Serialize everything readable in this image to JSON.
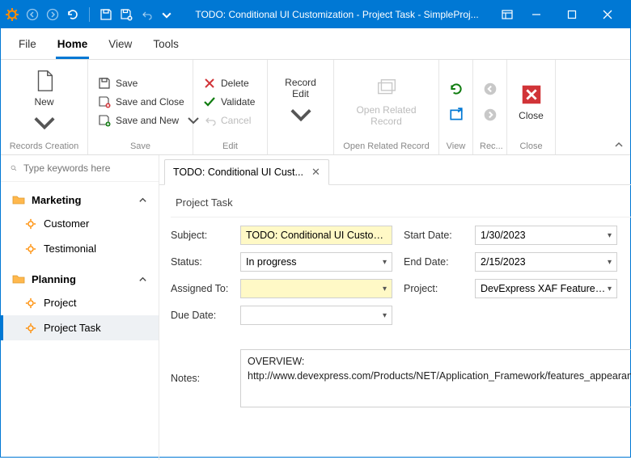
{
  "window": {
    "title": "TODO: Conditional UI Customization - Project Task - SimpleProj..."
  },
  "tabs": {
    "file": "File",
    "home": "Home",
    "view": "View",
    "tools": "Tools"
  },
  "ribbon": {
    "records_creation": {
      "new": "New",
      "label": "Records Creation"
    },
    "save": {
      "save": "Save",
      "save_close": "Save and Close",
      "save_new": "Save and New",
      "label": "Save"
    },
    "edit": {
      "delete": "Delete",
      "validate": "Validate",
      "cancel": "Cancel",
      "label": "Edit"
    },
    "record_edit": {
      "button": "Record\nEdit",
      "label": ""
    },
    "open_related": {
      "button": "Open Related\nRecord",
      "label": "Open Related Record"
    },
    "view": {
      "label": "View"
    },
    "rec": {
      "label": "Rec..."
    },
    "close": {
      "button": "Close",
      "label": "Close"
    }
  },
  "search": {
    "placeholder": "Type keywords here"
  },
  "nav": {
    "groups": [
      {
        "name": "Marketing",
        "items": [
          "Customer",
          "Testimonial"
        ]
      },
      {
        "name": "Planning",
        "items": [
          "Project",
          "Project Task"
        ]
      }
    ]
  },
  "doctab": "TODO: Conditional UI Cust...",
  "form": {
    "header": "Project Task",
    "subject_lbl": "Subject:",
    "subject": "TODO: Conditional UI Customization",
    "status_lbl": "Status:",
    "status": "In progress",
    "assigned_lbl": "Assigned To:",
    "assigned": "",
    "due_lbl": "Due Date:",
    "due": "",
    "start_lbl": "Start Date:",
    "start": "1/30/2023",
    "end_lbl": "End Date:",
    "end": "2/15/2023",
    "project_lbl": "Project:",
    "project": "DevExpress XAF Features Over...",
    "notes_lbl": "Notes:",
    "notes": "OVERVIEW:\nhttp://www.devexpress.com/Products/NET/Application_Framework/features_appearance.xml"
  }
}
